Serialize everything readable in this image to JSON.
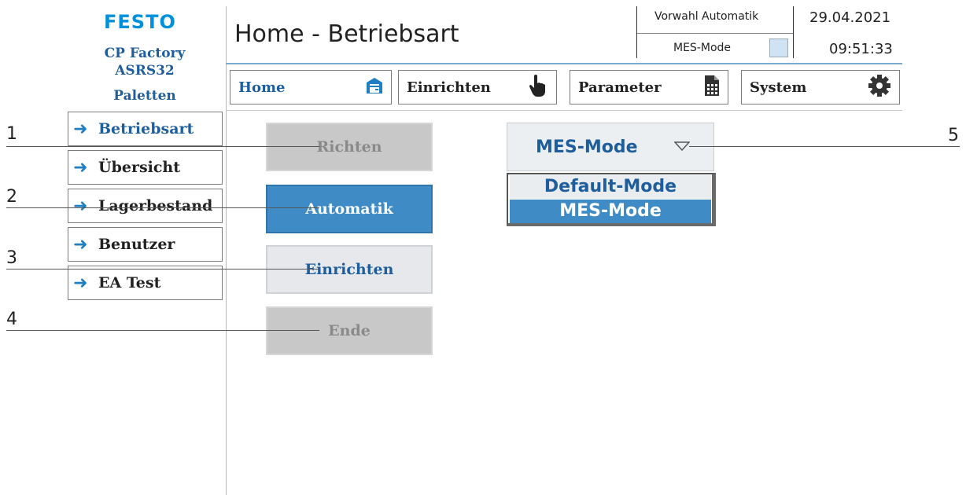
{
  "brand": {
    "logo": "FESTO",
    "line1": "CP Factory",
    "line2": "ASRS32",
    "line3": "Paletten"
  },
  "header": {
    "title": "Home - Betriebsart",
    "vorwahl_label": "Vorwahl Automatik",
    "mes_label": "MES-Mode",
    "date": "29.04.2021",
    "time": "09:51:33"
  },
  "nav": [
    {
      "label": "Home",
      "icon": "house-icon"
    },
    {
      "label": "Einrichten",
      "icon": "hand-pointer-icon"
    },
    {
      "label": "Parameter",
      "icon": "document-icon"
    },
    {
      "label": "System",
      "icon": "gear-icon"
    }
  ],
  "sidebar": {
    "items": [
      {
        "label": "Betriebsart"
      },
      {
        "label": "Übersicht"
      },
      {
        "label": "Lagerbestand"
      },
      {
        "label": "Benutzer"
      },
      {
        "label": "EA Test"
      }
    ]
  },
  "main": {
    "buttons": [
      {
        "label": "Richten",
        "state": "disabled"
      },
      {
        "label": "Automatik",
        "state": "active"
      },
      {
        "label": "Einrichten",
        "state": "normal"
      },
      {
        "label": "Ende",
        "state": "disabled"
      }
    ]
  },
  "mode_select": {
    "selected": "MES-Mode",
    "options": [
      "Default-Mode",
      "MES-Mode"
    ]
  },
  "callouts": [
    "1",
    "2",
    "3",
    "4",
    "5"
  ],
  "colors": {
    "accent": "#3e8bc6",
    "label_blue": "#1f5e9c",
    "logo_blue": "#0091dc"
  }
}
